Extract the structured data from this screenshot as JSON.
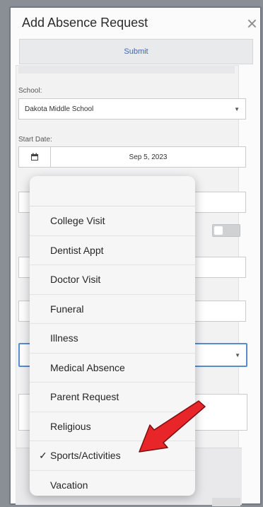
{
  "modal": {
    "title": "Add Absence Request",
    "close_symbol": "×",
    "submit_label": "Submit"
  },
  "form": {
    "school_label": "School:",
    "school_value": "Dakota Middle School",
    "start_date_label": "Start Date:",
    "start_date_value": "Sep 5, 2023"
  },
  "dropdown": {
    "selected": "Sports/Activities",
    "items": [
      {
        "label": "College Visit",
        "checked": false
      },
      {
        "label": "Dentist Appt",
        "checked": false
      },
      {
        "label": "Doctor Visit",
        "checked": false
      },
      {
        "label": "Funeral",
        "checked": false
      },
      {
        "label": "Illness",
        "checked": false
      },
      {
        "label": "Medical Absence",
        "checked": false
      },
      {
        "label": "Parent Request",
        "checked": false
      },
      {
        "label": "Religious",
        "checked": false
      },
      {
        "label": "Sports/Activities",
        "checked": true
      },
      {
        "label": "Vacation",
        "checked": false
      }
    ]
  },
  "icons": {
    "calendar": "calendar-icon",
    "caret": "caret-down-icon",
    "close": "close-icon",
    "check": "checkmark-icon",
    "annotation_arrow": "red-arrow-annotation"
  },
  "colors": {
    "accent": "#3d66ad",
    "annotation": "#e8262a",
    "focus_border": "#5a8ccc"
  }
}
